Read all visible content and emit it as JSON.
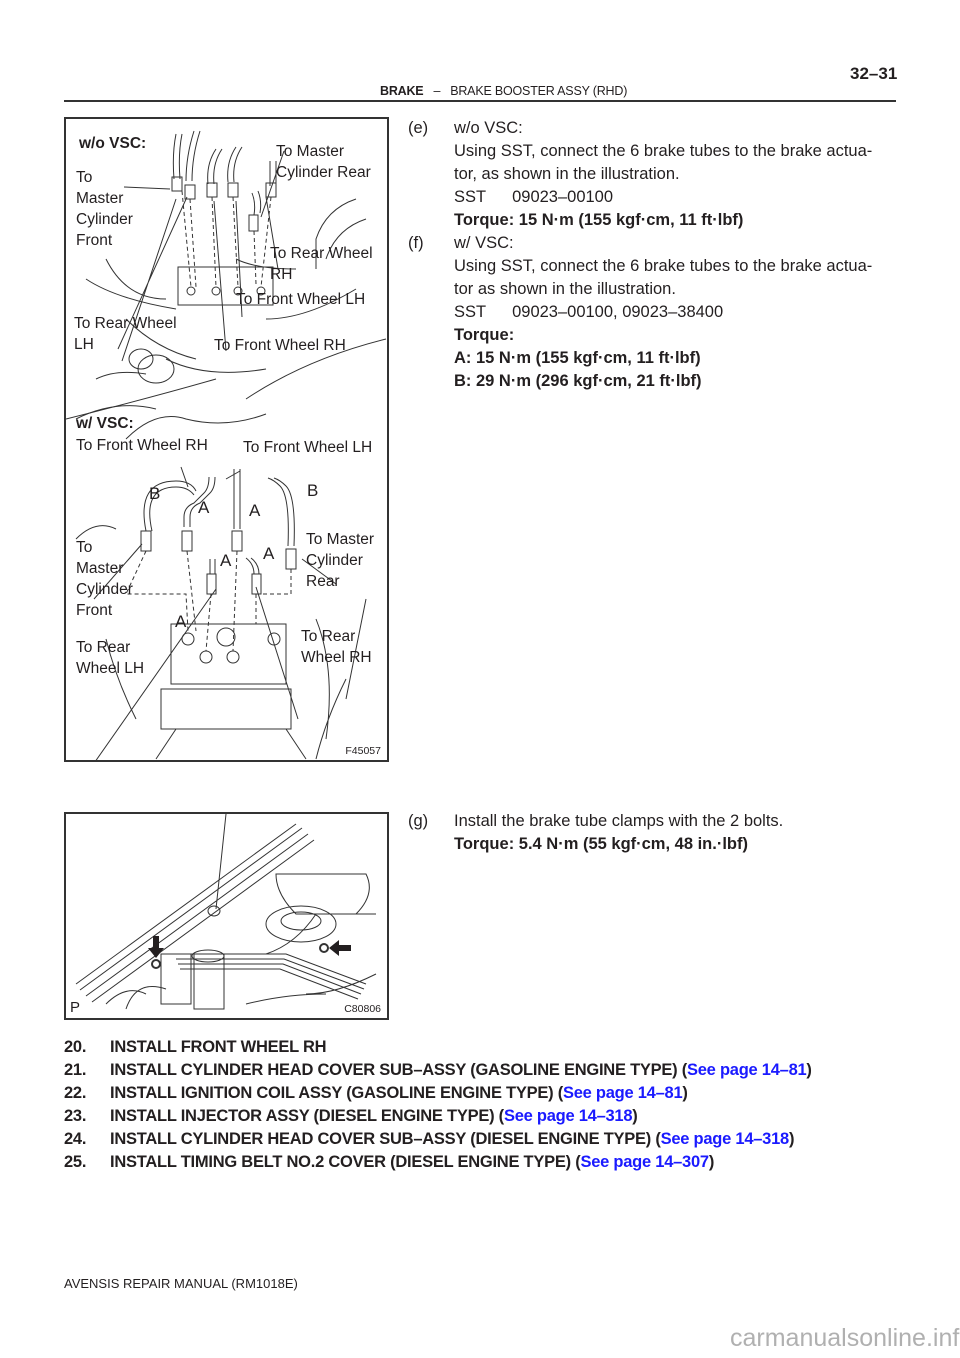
{
  "header": {
    "section": "BRAKE",
    "separator": "–",
    "subsection": "BRAKE BOOSTER ASSY (RHD)",
    "page_number": "32–31"
  },
  "figure1": {
    "code": "F45057",
    "wo_vsc": {
      "heading": "w/o VSC:",
      "labels": {
        "to_master_cyl_front": "To\nMaster\nCylinder\nFront",
        "to_master_cyl_rear": "To Master\nCylinder Rear",
        "to_rear_wheel_rh": "To Rear Wheel\nRH",
        "to_front_wheel_lh": "To Front Wheel LH",
        "to_rear_wheel_lh": "To Rear Wheel\nLH",
        "to_front_wheel_rh": "To Front Wheel RH"
      }
    },
    "w_vsc": {
      "heading": "w/ VSC:",
      "labels": {
        "to_front_wheel_rh": "To Front Wheel RH",
        "to_front_wheel_lh": "To Front Wheel LH",
        "to_master_cyl_front": "To\nMaster\nCylinder\nFront",
        "to_master_cyl_rear": "To Master\nCylinder\nRear",
        "to_rear_wheel_lh": "To Rear\nWheel LH",
        "to_rear_wheel_rh": "To Rear\nWheel RH"
      },
      "torque_marks": {
        "a": "A",
        "b": "B"
      }
    }
  },
  "figure2": {
    "code": "C80806",
    "corner_mark": "P"
  },
  "steps": {
    "e": {
      "letter": "(e)",
      "condition": "w/o VSC:",
      "line1": "Using SST, connect the 6 brake tubes to the brake actua-",
      "line2": "tor, as shown in the illustration.",
      "sst_label": "SST",
      "sst_value": "09023–00100",
      "torque": "Torque: 15 N·m (155 kgf·cm, 11 ft·lbf)"
    },
    "f": {
      "letter": "(f)",
      "condition": "w/ VSC:",
      "line1": "Using SST, connect the 6 brake tubes to the brake actua-",
      "line2": "tor as shown in the illustration.",
      "sst_label": "SST",
      "sst_value": "09023–00100,  09023–38400",
      "torque_label": "Torque:",
      "torque_a": "A: 15 N·m (155 kgf·cm, 11 ft·lbf)",
      "torque_b": "B: 29 N·m (296 kgf·cm, 21 ft·lbf)"
    },
    "g": {
      "letter": "(g)",
      "line1": "Install the brake tube clamps with the 2 bolts.",
      "torque": "Torque: 5.4 N·m (55 kgf·cm, 48 in.·lbf)"
    }
  },
  "procedures": [
    {
      "num": "20.",
      "text": "INSTALL FRONT WHEEL RH",
      "link": null
    },
    {
      "num": "21.",
      "text": "INSTALL CYLINDER HEAD COVER SUB–ASSY (GASOLINE ENGINE TYPE) (",
      "link": "See page 14–81"
    },
    {
      "num": "22.",
      "text": "INSTALL IGNITION COIL ASSY (GASOLINE ENGINE TYPE) (",
      "link": "See page 14–81"
    },
    {
      "num": "23.",
      "text": "INSTALL INJECTOR ASSY (DIESEL ENGINE TYPE) (",
      "link": "See page 14–318"
    },
    {
      "num": "24.",
      "text": "INSTALL CYLINDER HEAD COVER SUB–ASSY (DIESEL ENGINE TYPE) (",
      "link": "See page 14–318"
    },
    {
      "num": "25.",
      "text": "INSTALL TIMING BELT NO.2 COVER (DIESEL ENGINE TYPE) (",
      "link": "See page 14–307"
    }
  ],
  "closing_paren": ")",
  "footer": "AVENSIS REPAIR MANUAL   (RM1018E)",
  "watermark": "carmanualsonline.info",
  "colors": {
    "link": "#1a1aff",
    "text": "#231f20"
  }
}
